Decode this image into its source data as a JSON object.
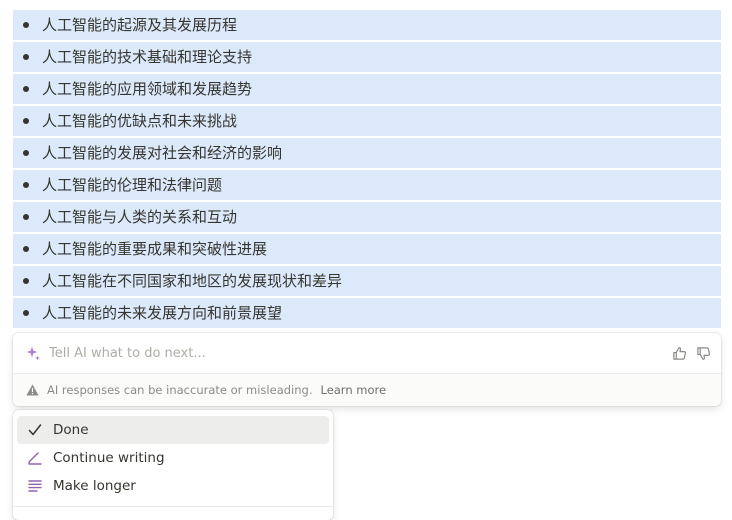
{
  "list": {
    "items": [
      "人工智能的起源及其发展历程",
      "人工智能的技术基础和理论支持",
      "人工智能的应用领域和发展趋势",
      "人工智能的优缺点和未来挑战",
      "人工智能的发展对社会和经济的影响",
      "人工智能的伦理和法律问题",
      "人工智能与人类的关系和互动",
      "人工智能的重要成果和突破性进展",
      "人工智能在不同国家和地区的发展现状和差异",
      "人工智能的未来发展方向和前景展望"
    ],
    "highlight_color": "#dbe9fb"
  },
  "ai_panel": {
    "placeholder": "Tell AI what to do next...",
    "icons": [
      "sparkle-icon",
      "thumbs-up-icon",
      "thumbs-down-icon"
    ],
    "disclaimer": "AI responses can be inaccurate or misleading.",
    "learn_more": "Learn more",
    "accent_color": "#a77ed6"
  },
  "menu": {
    "items": [
      {
        "label": "Done",
        "icon": "check-icon"
      },
      {
        "label": "Continue writing",
        "icon": "pen-icon"
      },
      {
        "label": "Make longer",
        "icon": "lines-icon"
      }
    ],
    "accent_color": "#9065b0"
  }
}
